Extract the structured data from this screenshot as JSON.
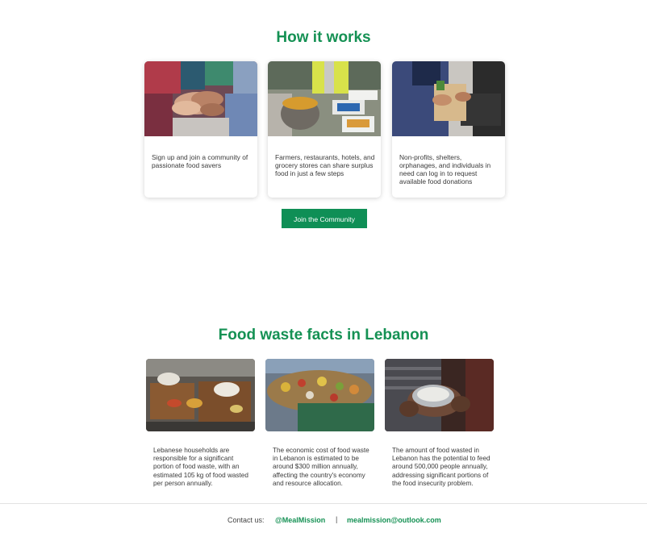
{
  "how_it_works": {
    "title": "How it works",
    "cards": [
      {
        "image": "hands-stacked-together-photo",
        "text": "Sign up and join a community of passionate food savers"
      },
      {
        "image": "food-containers-sharing-photo",
        "text": "Farmers, restaurants, hotels, and grocery stores can share surplus food in just a few steps"
      },
      {
        "image": "food-bag-handover-photo",
        "text": "Non-profits, shelters, orphanages, and individuals in need can log in to request available food donations"
      }
    ],
    "cta_label": "Join the Community"
  },
  "facts": {
    "title": "Food waste facts in Lebanon",
    "items": [
      {
        "image": "leftover-food-trays-photo",
        "text": "Lebanese households are responsible for a significant portion of food waste, with an estimated 105 kg of food wasted per person annually."
      },
      {
        "image": "discarded-produce-dumpster-photo",
        "text": "The economic cost of food waste in Lebanon is estimated to be around $300 million annually, affecting the country's economy and resource allocation."
      },
      {
        "image": "hands-holding-rice-bowl-photo",
        "text": "The amount of food wasted in Lebanon has the potential to feed around 500,000 people annually, addressing significant portions of the food insecurity problem."
      }
    ]
  },
  "footer": {
    "contact_label": "Contact us:",
    "handle": "@MealMission",
    "separator": "|",
    "email": "mealmission@outlook.com"
  },
  "colors": {
    "brand_green": "#159154",
    "button_green": "#0f8f56",
    "body_text": "#3a3a3a"
  }
}
